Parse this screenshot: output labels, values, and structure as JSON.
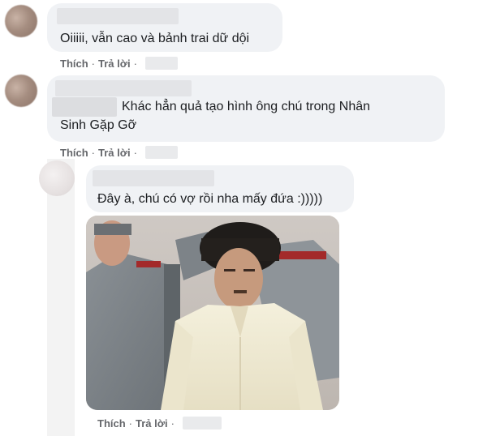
{
  "comments": [
    {
      "text": "Oiiiii, vẫn cao và bảnh trai dữ dội",
      "actions": {
        "like": "Thích",
        "reply": "Trả lời"
      }
    },
    {
      "text_line1": "Khác hẳn quả tạo hình ông chú trong Nhân",
      "text_line2": "Sinh Gặp Gỡ",
      "actions": {
        "like": "Thích",
        "reply": "Trả lời"
      }
    },
    {
      "text": "Đây à, chú có vợ rồi nha mấy đứa :)))))",
      "actions": {
        "like": "Thích",
        "reply": "Trả lời"
      }
    }
  ],
  "separator": "·",
  "colors": {
    "bubble": "#f0f2f5",
    "action_text": "#65676b",
    "comment_text": "#1c1e21"
  },
  "icons": {
    "avatar": "user-avatar-blurred",
    "photo": "comment-photo"
  }
}
